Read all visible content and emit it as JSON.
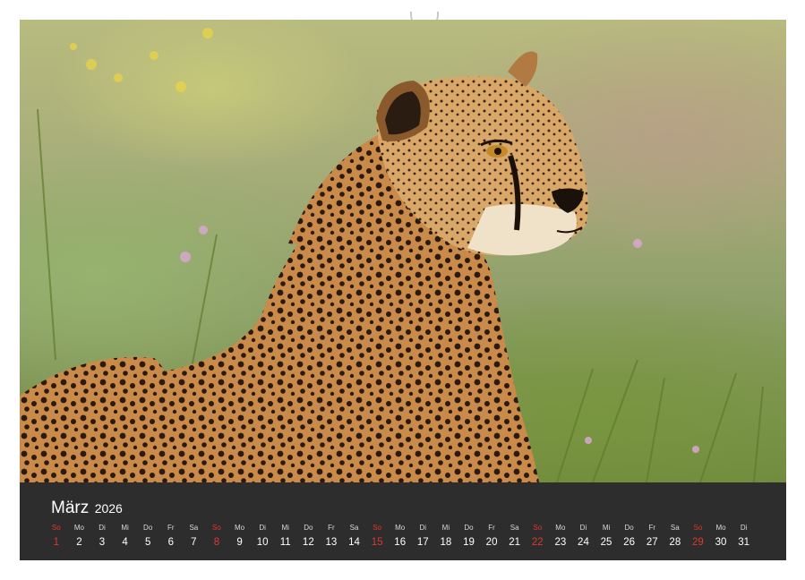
{
  "calendar": {
    "month": "März",
    "year": "2026",
    "weekdays": [
      "So",
      "Mo",
      "Di",
      "Mi",
      "Do",
      "Fr",
      "Sa",
      "So",
      "Mo",
      "Di",
      "Mi",
      "Do",
      "Fr",
      "Sa",
      "So",
      "Mo",
      "Di",
      "Mi",
      "Do",
      "Fr",
      "Sa",
      "So",
      "Mo",
      "Di",
      "Mi",
      "Do",
      "Fr",
      "Sa",
      "So",
      "Mo",
      "Di"
    ],
    "dates": [
      "1",
      "2",
      "3",
      "4",
      "5",
      "6",
      "7",
      "8",
      "9",
      "10",
      "11",
      "12",
      "13",
      "14",
      "15",
      "16",
      "17",
      "18",
      "19",
      "20",
      "21",
      "22",
      "23",
      "24",
      "25",
      "26",
      "27",
      "28",
      "29",
      "30",
      "31"
    ],
    "sunday_color": "#e1372c",
    "text_color": "#ffffff",
    "background_color": "#2d2d2d"
  },
  "photo": {
    "subject": "cheetah-in-grass"
  }
}
